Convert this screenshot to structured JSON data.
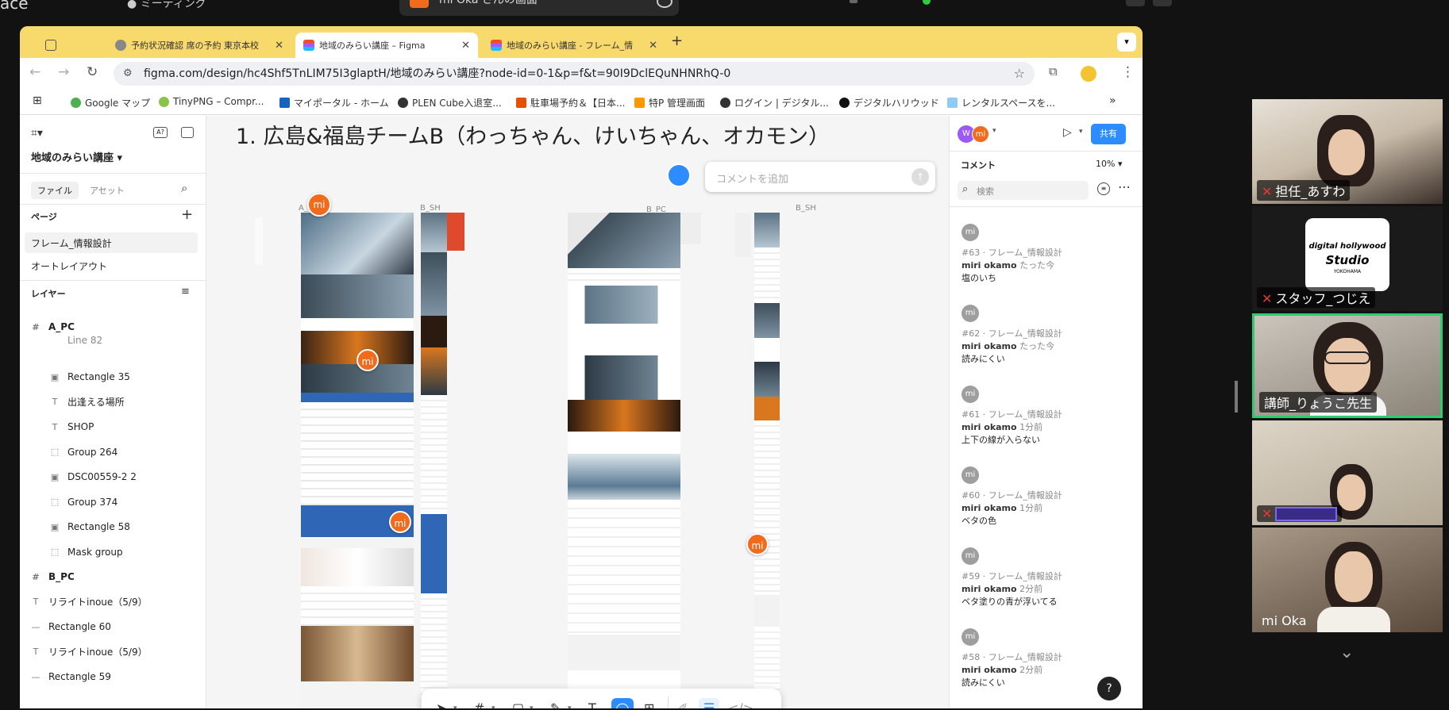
{
  "zoom_top": {
    "left_text": "ace",
    "user_label": "ミーティング",
    "share_label": "mi Oka さんの画面"
  },
  "browser": {
    "tabs": [
      {
        "label": "予約状況確認 席の予約 東京本校",
        "active": false
      },
      {
        "label": "地域のみらい講座 – Figma",
        "active": true
      },
      {
        "label": "地域のみらい講座 - フレーム_情",
        "active": false
      }
    ],
    "new_tab": "+",
    "url": "figma.com/design/hc4Shf5TnLIM75I3glaptH/地域のみらい講座?node-id=0-1&p=f&t=90I9DclEQuNHNRhQ-0",
    "bookmarks": [
      "Google マップ",
      "TinyPNG – Compr...",
      "マイポータル - ホーム",
      "PLEN Cube入退室...",
      "駐車場予約＆【日本...",
      "特P 管理画面",
      "ログイン | デジタル...",
      "デジタルハリウッド",
      "レンタルスペースを..."
    ]
  },
  "figma": {
    "file_name": "地域のみらい講座",
    "tabs": {
      "file": "ファイル",
      "assets": "アセット"
    },
    "pages_header": "ページ",
    "pages": [
      "フレーム_情報設計",
      "オートレイアウト"
    ],
    "layers_header": "レイヤー",
    "layers": [
      {
        "icon": "#",
        "label": "A_PC",
        "bold": true,
        "indent": 0
      },
      {
        "icon": "",
        "label": "Line 82",
        "bold": false,
        "indent": 1
      },
      {
        "icon": "▣",
        "label": "Rectangle 35",
        "bold": false,
        "indent": 1
      },
      {
        "icon": "T",
        "label": "出逢える場所",
        "bold": false,
        "indent": 1
      },
      {
        "icon": "T",
        "label": "SHOP",
        "bold": false,
        "indent": 1
      },
      {
        "icon": "⬚",
        "label": "Group 264",
        "bold": false,
        "indent": 1
      },
      {
        "icon": "▣",
        "label": "DSC00559-2 2",
        "bold": false,
        "indent": 1
      },
      {
        "icon": "⬚",
        "label": "Group 374",
        "bold": false,
        "indent": 1
      },
      {
        "icon": "▣",
        "label": "Rectangle 58",
        "bold": false,
        "indent": 1
      },
      {
        "icon": "⬚",
        "label": "Mask group",
        "bold": false,
        "indent": 1
      },
      {
        "icon": "#",
        "label": "B_PC",
        "bold": true,
        "indent": 0
      },
      {
        "icon": "T",
        "label": "リライトinoue（5/9）",
        "bold": false,
        "indent": 0
      },
      {
        "icon": "—",
        "label": "Rectangle 60",
        "bold": false,
        "indent": 0
      },
      {
        "icon": "T",
        "label": "リライトinoue（5/9）",
        "bold": false,
        "indent": 0
      },
      {
        "icon": "—",
        "label": "Rectangle 59",
        "bold": false,
        "indent": 0
      }
    ],
    "canvas_title": "1. 広島&福島チームB（わっちゃん、けいちゃん、オカモン）",
    "comment_input_placeholder": "コメントを追加",
    "frame_labels": [
      "A_PC",
      "B_SH",
      "B_PC",
      "B_SH"
    ],
    "avatar_label": "mi",
    "share_button": "共有",
    "comments_header": "コメント",
    "zoom_level": "10%",
    "search_placeholder": "検索",
    "comments": [
      {
        "id": "#63 · フレーム_情報設計",
        "author": "miri okamo",
        "time": "たった今",
        "text": "塩のいち"
      },
      {
        "id": "#62 · フレーム_情報設計",
        "author": "miri okamo",
        "time": "たった今",
        "text": "読みにくい"
      },
      {
        "id": "#61 · フレーム_情報設計",
        "author": "miri okamo",
        "time": "1分前",
        "text": "上下の線が入らない"
      },
      {
        "id": "#60 · フレーム_情報設計",
        "author": "miri okamo",
        "time": "1分前",
        "text": "ベタの色"
      },
      {
        "id": "#59 · フレーム_情報設計",
        "author": "miri okamo",
        "time": "2分前",
        "text": "ベタ塗りの青が浮いてる"
      },
      {
        "id": "#58 · フレーム_情報設計",
        "author": "miri okamo",
        "time": "2分前",
        "text": "読みにくい"
      }
    ],
    "help": "?"
  },
  "participants": [
    {
      "name": "担任_あすわ",
      "muted": true
    },
    {
      "name": "スタッフ_つじえ",
      "muted": true
    },
    {
      "name": "講師_りょうこ先生",
      "muted": false
    },
    {
      "name": "",
      "muted": true
    },
    {
      "name": "mi Oka",
      "muted": false
    }
  ],
  "participant_logo": {
    "line1": "digital hollywood",
    "line2": "Studio",
    "line3": "YOKOHAMA"
  }
}
